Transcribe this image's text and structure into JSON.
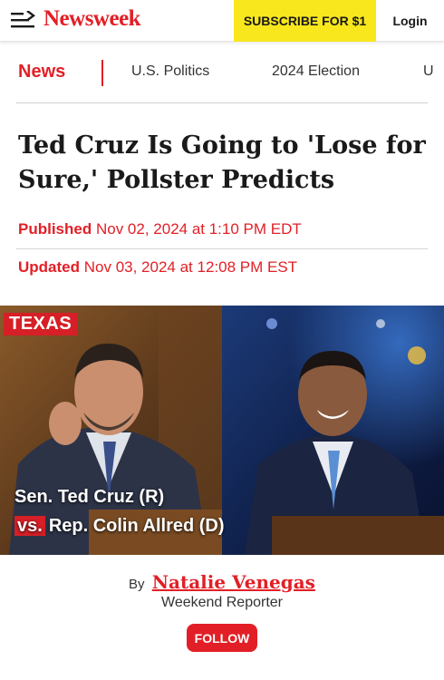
{
  "header": {
    "logo": "Newsweek",
    "subscribe_label": "SUBSCRIBE FOR $1",
    "login_label": "Login"
  },
  "section_nav": {
    "current": "News",
    "links": [
      "U.S. Politics",
      "2024 Election",
      "U"
    ]
  },
  "article": {
    "headline": "Ted Cruz Is Going to 'Lose for Sure,' Pollster Predicts",
    "published_label": "Published",
    "published_value": "Nov 02, 2024 at 1:10 PM EDT",
    "updated_label": "Updated",
    "updated_value": "Nov 03, 2024 at 12:08 PM EST"
  },
  "photo": {
    "tag": "TEXAS",
    "caption_line1": "Sen. Ted Cruz (R)",
    "caption_vs": "vs.",
    "caption_line2": "Rep. Colin Allred (D)"
  },
  "byline": {
    "by_label": "By",
    "author": "Natalie Venegas",
    "role": "Weekend Reporter",
    "follow_label": "FOLLOW"
  },
  "colors": {
    "brand_red": "#e21f26",
    "subscribe_yellow": "#f8e71c"
  },
  "icons": [
    "menu-icon"
  ]
}
